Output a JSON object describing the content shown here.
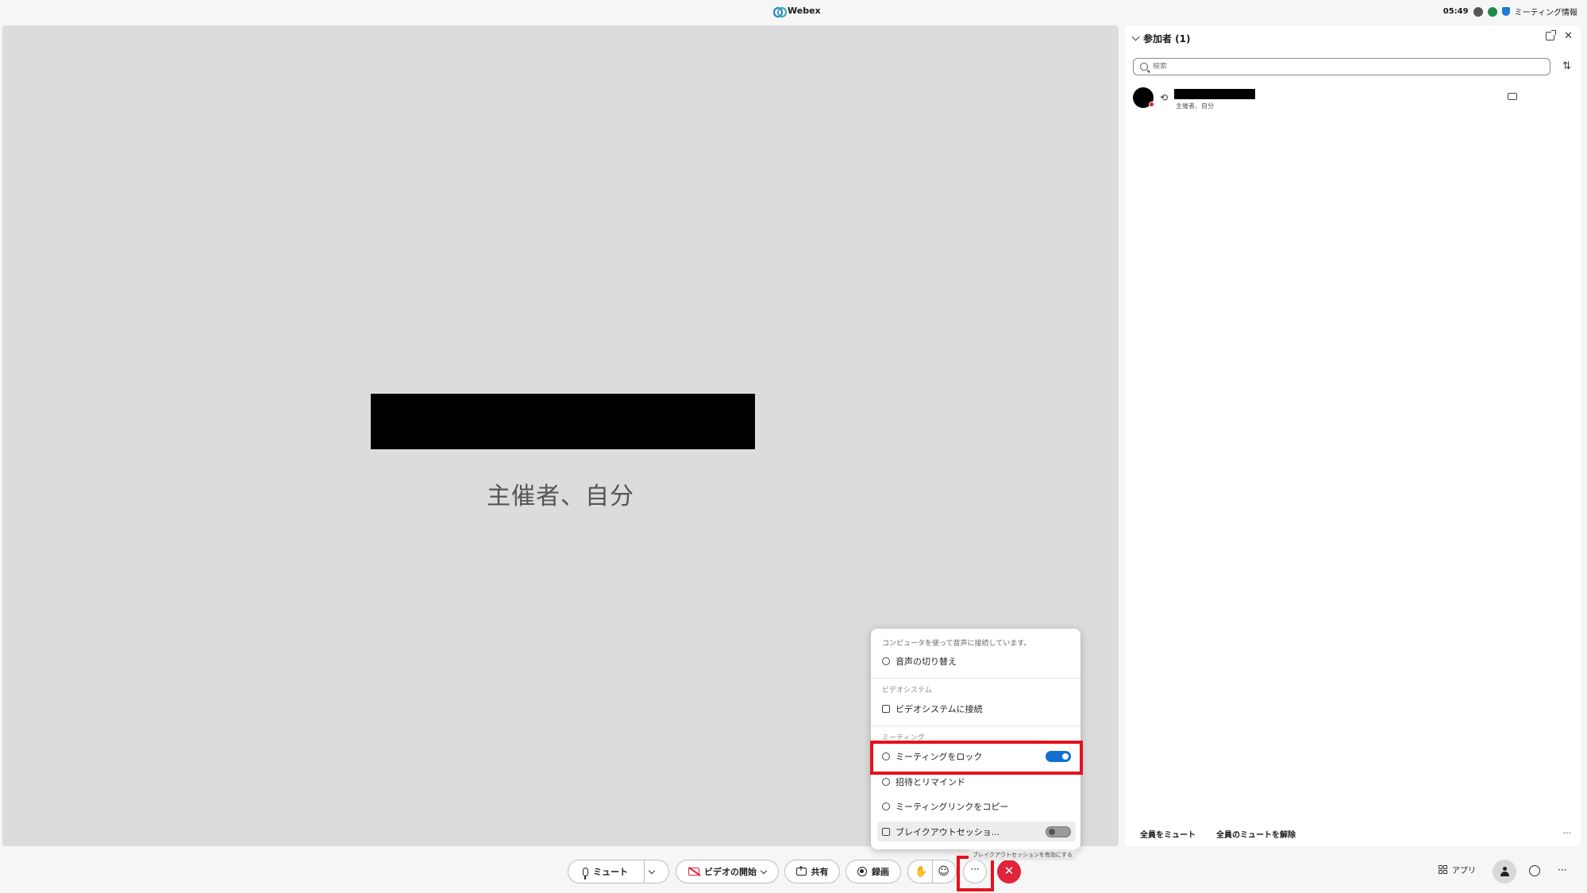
{
  "titlebar": {
    "app_title": "Webex",
    "time": "05:49",
    "meeting_info": "ミーティング情報"
  },
  "stage": {
    "video_label": "主催者、自分"
  },
  "panel": {
    "header": "参加者 (1)",
    "search_placeholder": "検索",
    "participant": {
      "role": "主催者、自分"
    },
    "footer": {
      "mute_all": "全員をミュート",
      "unmute_all": "全員のミュートを解除",
      "more": "···"
    }
  },
  "toolbar": {
    "mute": "ミュート",
    "start_video": "ビデオの開始",
    "share": "共有",
    "record": "録画",
    "more": "···",
    "end": "✕",
    "apps": "アプリ",
    "right_more": "···"
  },
  "menu": {
    "audio_note": "コンピュータを使って音声に接続しています。",
    "switch_audio": "音声の切り替え",
    "section_video": "ビデオシステム",
    "connect_video_system": "ビデオシステムに接続",
    "section_meeting": "ミーティング",
    "lock_meeting": "ミーティングをロック",
    "lock_meeting_state": true,
    "invite_remind": "招待とリマインド",
    "copy_link": "ミーティングリンクをコピー",
    "breakout": "ブレイクアウトセッショ...",
    "breakout_state": false,
    "tooltip": "ブレイクアウトセッションを有効にする"
  },
  "colors": {
    "accent": "#1170cf",
    "end_call": "#e0243a",
    "highlight": "#e8101e"
  }
}
